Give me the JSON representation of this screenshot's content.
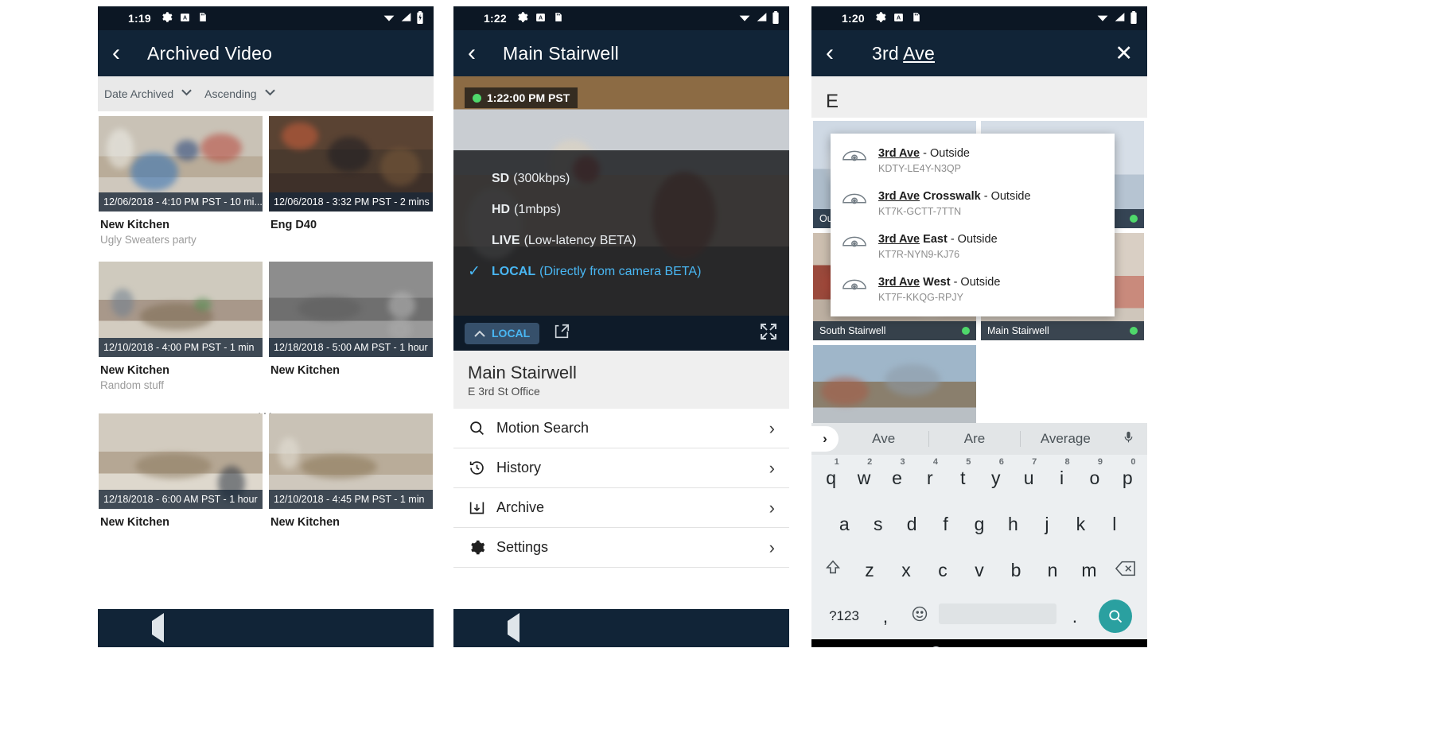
{
  "panel1": {
    "status": {
      "time": "1:19",
      "icons": [
        "gear-icon",
        "alert-icon",
        "sdcard-icon",
        "wifi-icon",
        "signal-icon",
        "battery-icon"
      ]
    },
    "appbar": {
      "back": "‹",
      "title": "Archived Video"
    },
    "sort": {
      "field": "Date Archived",
      "order": "Ascending",
      "chevron": "⌄"
    },
    "items": [
      {
        "caption": "12/06/2018 - 4:10 PM PST - 10 mi...",
        "name": "New Kitchen",
        "sub": "Ugly Sweaters party",
        "art": "t-kitchen"
      },
      {
        "caption": "12/06/2018 - 3:32 PM PST - 2 mins",
        "name": "Eng D40",
        "sub": "",
        "art": "t-eng"
      },
      {
        "caption": "12/10/2018 - 4:00 PM PST - 1 min",
        "name": "New Kitchen",
        "sub": "Random stuff",
        "art": "t-kitchen2"
      },
      {
        "caption": "12/18/2018 - 5:00 AM PST - 1 hour",
        "name": "New Kitchen",
        "sub": "",
        "art": "t-gray"
      },
      {
        "caption": "12/18/2018 - 6:00 AM PST - 1 hour",
        "name": "New Kitchen",
        "sub": "",
        "art": "t-kitchen3"
      },
      {
        "caption": "12/10/2018 - 4:45 PM PST - 1 min",
        "name": "New Kitchen",
        "sub": "",
        "art": "t-kitchen"
      }
    ],
    "ellipsis": "..."
  },
  "panel2": {
    "status": {
      "time": "1:22"
    },
    "appbar": {
      "back": "‹",
      "title": "Main Stairwell"
    },
    "player": {
      "timestamp": "1:22:00 PM PST",
      "quality_options": [
        {
          "label": "SD",
          "detail": "(300kbps)",
          "selected": false
        },
        {
          "label": "HD",
          "detail": "(1mbps)",
          "selected": false
        },
        {
          "label": "LIVE",
          "detail": "(Low-latency BETA)",
          "selected": false
        },
        {
          "label": "LOCAL",
          "detail": "(Directly from camera BETA)",
          "selected": true
        }
      ],
      "current_quality": "LOCAL",
      "check": "✓",
      "caret_up": "⌃",
      "share_icon": "share-icon",
      "expand_icon": "fullscreen-icon"
    },
    "camera": {
      "name": "Main Stairwell",
      "location": "E 3rd St Office"
    },
    "menu": [
      {
        "label": "Motion Search",
        "icon": "search-icon"
      },
      {
        "label": "History",
        "icon": "history-icon"
      },
      {
        "label": "Archive",
        "icon": "archive-icon"
      },
      {
        "label": "Settings",
        "icon": "gear-icon"
      }
    ],
    "arrow": "›"
  },
  "panel3": {
    "status": {
      "time": "1:20"
    },
    "appbar": {
      "back": "‹",
      "query_prefix": "3rd ",
      "query_match": "Ave",
      "close": "✕"
    },
    "behind_title": "E",
    "dropdown": [
      {
        "match": "3rd Ave",
        "rest": " - Outside",
        "code": "KDTY-LE4Y-N3QP",
        "icon": "camera-dome-icon"
      },
      {
        "match": "3rd Ave",
        "bold": " Crosswalk",
        "rest": "  - Outside",
        "code": "KT7K-GCTT-7TTN",
        "icon": "camera-dome-icon"
      },
      {
        "match": "3rd Ave",
        "bold": " East",
        "rest": " - Outside",
        "code": "KT7R-NYN9-KJ76",
        "icon": "camera-dome-icon"
      },
      {
        "match": "3rd Ave",
        "bold": " West",
        "rest": " - Outside",
        "code": "KT7F-KKQG-RPJY",
        "icon": "camera-dome-icon"
      }
    ],
    "cards": [
      {
        "label": "Outside",
        "art": "a1",
        "online": true
      },
      {
        "label": "",
        "art": "a2",
        "online": true
      },
      {
        "label": "South Stairwell",
        "art": "a3",
        "online": true
      },
      {
        "label": "Main Stairwell",
        "art": "a4",
        "online": true
      },
      {
        "label": "",
        "art": "a5",
        "online": false
      }
    ],
    "keyboard": {
      "expand": "›",
      "suggestions": [
        "Ave",
        "Are",
        "Average"
      ],
      "mic_icon": "microphone-icon",
      "row1": [
        {
          "k": "q",
          "n": "1"
        },
        {
          "k": "w",
          "n": "2"
        },
        {
          "k": "e",
          "n": "3"
        },
        {
          "k": "r",
          "n": "4"
        },
        {
          "k": "t",
          "n": "5"
        },
        {
          "k": "y",
          "n": "6"
        },
        {
          "k": "u",
          "n": "7"
        },
        {
          "k": "i",
          "n": "8"
        },
        {
          "k": "o",
          "n": "9"
        },
        {
          "k": "p",
          "n": "0"
        }
      ],
      "row2": [
        "a",
        "s",
        "d",
        "f",
        "g",
        "h",
        "j",
        "k",
        "l"
      ],
      "row3": [
        "z",
        "x",
        "c",
        "v",
        "b",
        "n",
        "m"
      ],
      "shift_icon": "shift-icon",
      "backspace_icon": "backspace-icon",
      "symbols_key": "?123",
      "comma_key": ",",
      "emoji_key": "emoji-icon",
      "period_key": ".",
      "search_key_icon": "search-icon"
    },
    "navbar": {
      "down": "▼",
      "home": "home-circle-icon",
      "recents": "square-icon",
      "keyboard": "keyboard-icon"
    }
  },
  "sysnav": {
    "back": "back-triangle-icon",
    "home": "home-circle-icon",
    "recents": "square-icon"
  },
  "colors": {
    "appbar": "#112437",
    "status": "#0c1724",
    "accent": "#49b7f3",
    "online": "#4fd86b",
    "search_key": "#2aa0a0"
  }
}
